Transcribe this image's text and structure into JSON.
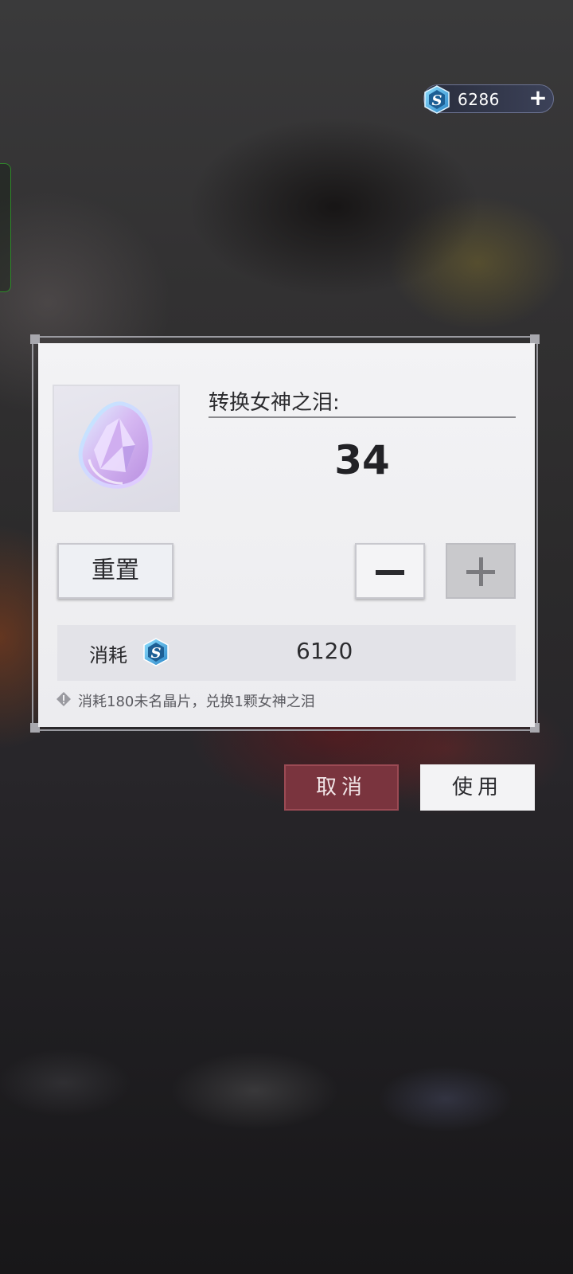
{
  "currency": {
    "amount": "6286",
    "icon": "s-crystal-icon",
    "add_icon": "plus-icon"
  },
  "dialog": {
    "title": "转换女神之泪:",
    "count": "34",
    "item_icon": "goddess-tear-gem-icon",
    "reset_label": "重置",
    "decrease_icon": "minus-icon",
    "increase_icon": "plus-icon",
    "cost_label": "消耗",
    "cost_value": "6120",
    "note": "消耗180未名晶片，兑换1颗女神之泪"
  },
  "actions": {
    "cancel_label": "取消",
    "use_label": "使用"
  },
  "colors": {
    "cancel_bg": "#7a343e",
    "dialog_bg": "#f0f0f2",
    "currency_accent": "#4fb8e8"
  }
}
